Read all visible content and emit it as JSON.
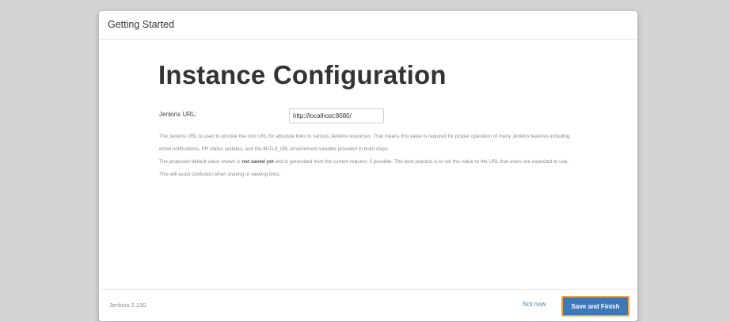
{
  "dialog": {
    "title": "Getting Started"
  },
  "main": {
    "heading": "Instance Configuration",
    "url_label": "Jenkins URL:",
    "url_value": "http://localhost:8080/",
    "help_p1_a": "The Jenkins URL is used to provide the root URL for absolute links to various Jenkins resources. That means this value is required for proper operation of many Jenkins features including email notifications, PR status updates, and the ",
    "help_p1_code": "BUILD_URL",
    "help_p1_b": " environment variable provided to build steps.",
    "help_p2_a": "The proposed default value shown is ",
    "help_p2_strong": "not saved yet",
    "help_p2_b": " and is generated from the current request, if possible. The best practice is to set this value to the URL that users are expected to use. This will avoid confusion when sharing or viewing links."
  },
  "footer": {
    "version": "Jenkins 2.130",
    "not_now_label": "Not now",
    "save_label": "Save and Finish"
  },
  "colors": {
    "primary_button": "#3d78b8",
    "focus_outline": "#f0a43a",
    "link": "#4a7fb5"
  }
}
